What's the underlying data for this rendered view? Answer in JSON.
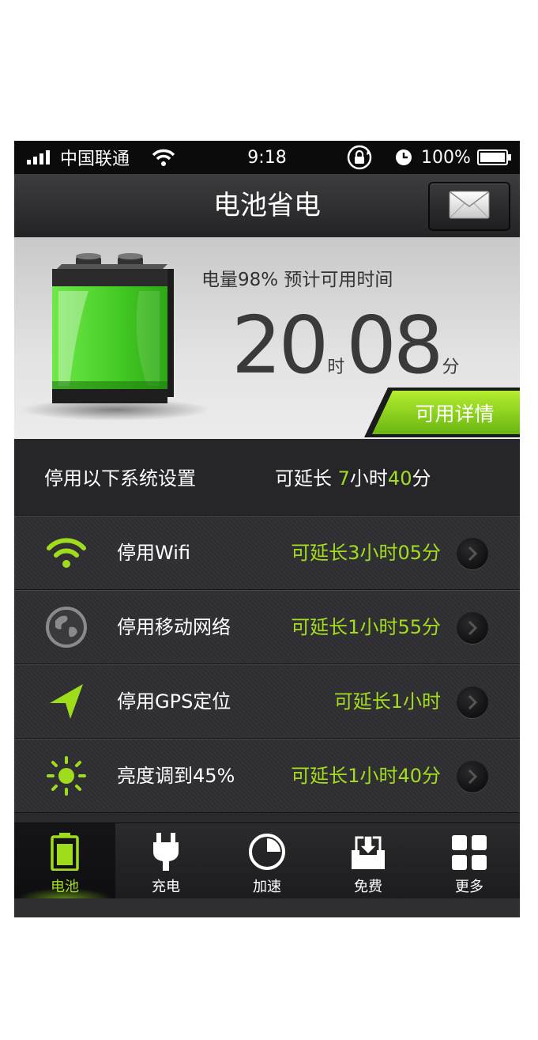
{
  "status_bar": {
    "carrier": "中国联通",
    "time": "9:18",
    "battery_percent": "100%",
    "icons": [
      "signal-icon",
      "wifi-icon",
      "rotation-lock-icon",
      "alarm-icon",
      "battery-icon"
    ]
  },
  "nav": {
    "title": "电池省电",
    "mail_icon": "envelope-icon"
  },
  "battery_panel": {
    "info": "电量98%  预计可用时间",
    "hours": "20",
    "hours_unit": "时",
    "minutes": "08",
    "minutes_unit": "分",
    "detail_button": "可用详情",
    "charge_level": 0.98,
    "accent_color": "#8fdc1e"
  },
  "summary": {
    "label": "停用以下系统设置",
    "prefix": "可延长 ",
    "hours": "7",
    "hours_unit": "小时",
    "minutes": "40",
    "minutes_unit": "分"
  },
  "settings": [
    {
      "icon": "wifi-icon",
      "label": "停用Wifi",
      "extend": "可延长3小时05分"
    },
    {
      "icon": "globe-icon",
      "label": "停用移动网络",
      "extend": "可延长1小时55分"
    },
    {
      "icon": "location-arrow-icon",
      "label": "停用GPS定位",
      "extend": "可延长1小时"
    },
    {
      "icon": "brightness-icon",
      "label": "亮度调到45%",
      "extend": "可延长1小时40分"
    }
  ],
  "tabs": [
    {
      "icon": "battery-icon",
      "label": "电池",
      "active": true
    },
    {
      "icon": "plug-icon",
      "label": "充电",
      "active": false
    },
    {
      "icon": "speed-pie-icon",
      "label": "加速",
      "active": false
    },
    {
      "icon": "download-tray-icon",
      "label": "免费",
      "active": false
    },
    {
      "icon": "grid-icon",
      "label": "更多",
      "active": false
    }
  ],
  "colors": {
    "accent_green": "#a3de1c",
    "nav_dark": "#2a2a2d"
  }
}
